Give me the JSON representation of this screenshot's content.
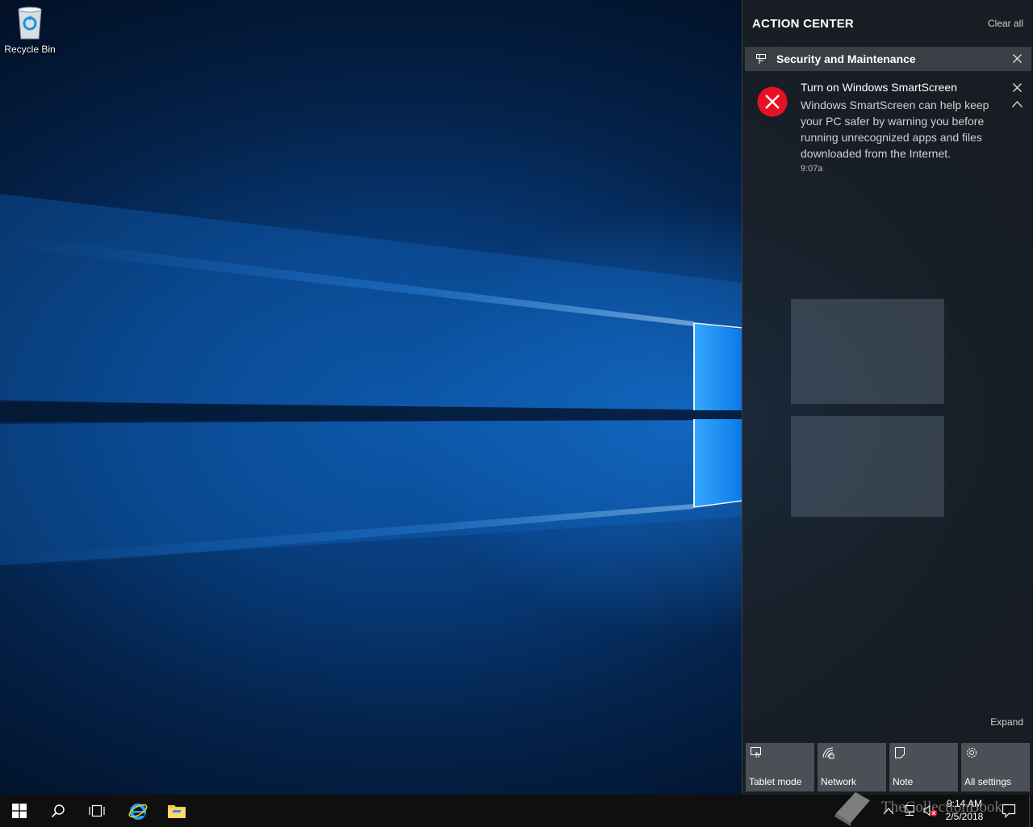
{
  "desktop": {
    "icons": [
      {
        "label": "Recycle Bin",
        "icon": "recycle-bin-icon"
      }
    ]
  },
  "action_center": {
    "title": "ACTION CENTER",
    "clear_all": "Clear all",
    "groups": [
      {
        "title": "Security and Maintenance",
        "icon": "security-maintenance-icon",
        "notifications": [
          {
            "title": "Turn on Windows SmartScreen",
            "body": "Windows SmartScreen can help keep your PC safer by warning you before running unrecognized apps and files downloaded from the Internet.",
            "time": "9:07a",
            "icon": "error-icon",
            "icon_color": "#e81123"
          }
        ]
      }
    ],
    "expand_label": "Expand",
    "quick_actions": [
      {
        "label": "Tablet mode",
        "icon": "tablet-mode-icon"
      },
      {
        "label": "Network",
        "icon": "network-icon"
      },
      {
        "label": "Note",
        "icon": "note-icon"
      },
      {
        "label": "All settings",
        "icon": "settings-icon"
      }
    ]
  },
  "taskbar": {
    "pinned": [
      "start-icon",
      "search-icon",
      "task-view-icon",
      "internet-explorer-icon",
      "file-explorer-icon"
    ],
    "tray_icons": [
      "show-hidden-icons-chevron",
      "network-tray-icon",
      "volume-muted-icon"
    ],
    "time": "9:14 AM",
    "date": "2/5/2018"
  },
  "watermark": {
    "text": "TheCollectionBook"
  },
  "colors": {
    "action_center_bg": "#1c1f24",
    "group_header_bg": "#3a3e45",
    "quick_tile_bg": "#4b4f56",
    "taskbar_bg": "#0f0f10",
    "error_red": "#e81123",
    "accent_blue": "#0078d7"
  }
}
